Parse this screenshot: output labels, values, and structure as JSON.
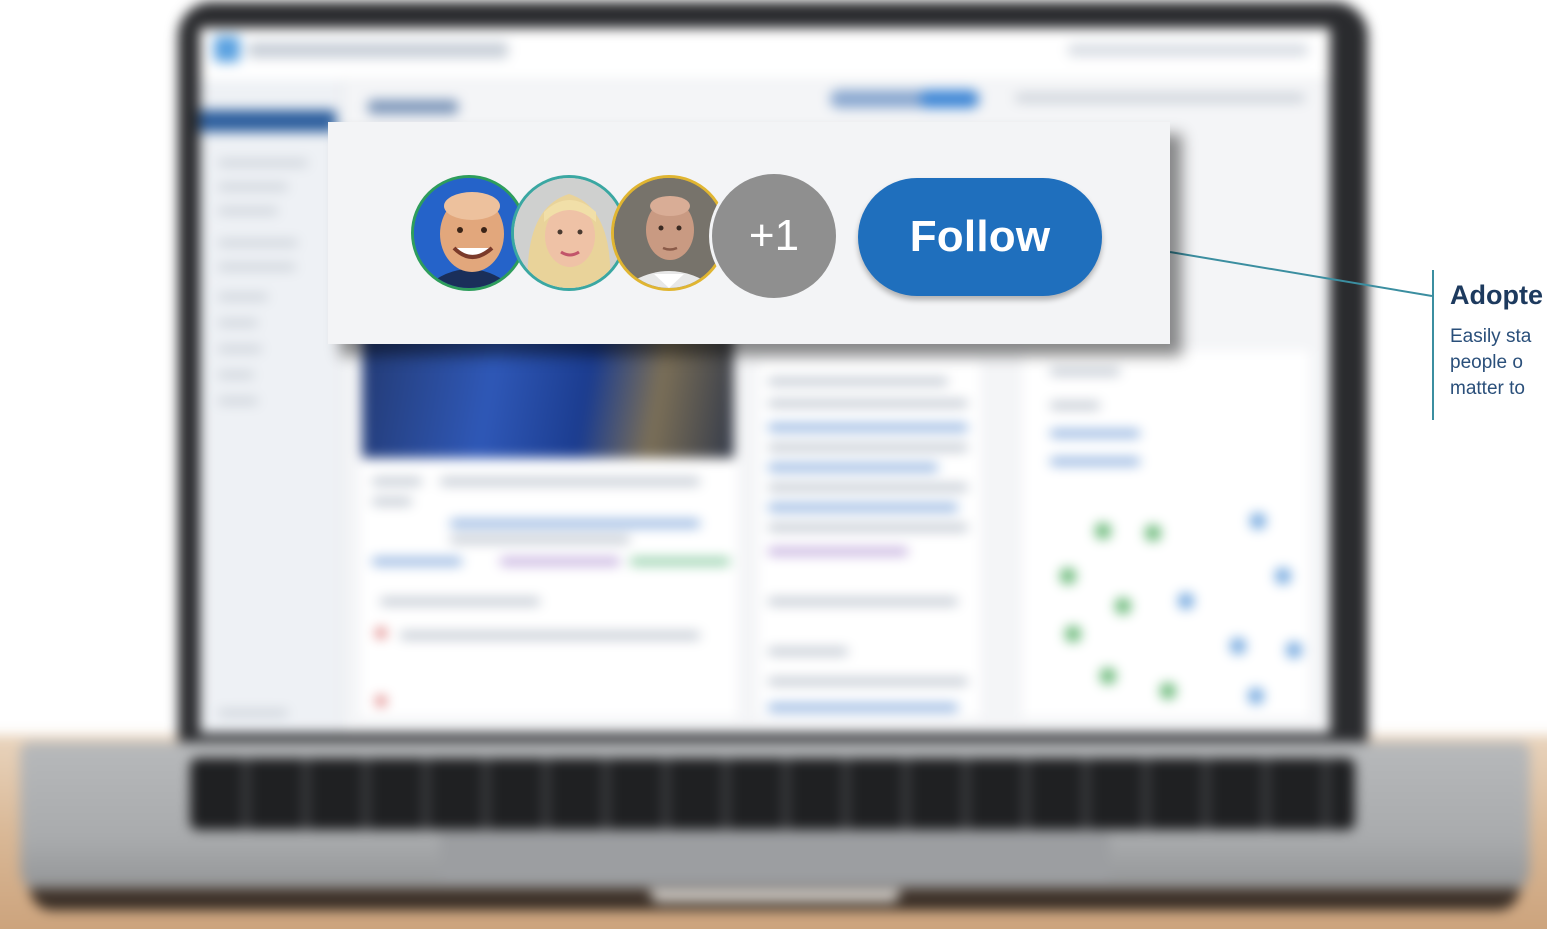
{
  "callout": {
    "extra_count": "+1",
    "follow_label": "Follow",
    "avatars": [
      {
        "ring_color": "#2e9d5c",
        "background": "#2563c9"
      },
      {
        "ring_color": "#3aa7a2",
        "background": "#d9d5cd"
      },
      {
        "ring_color": "#e0b531",
        "background": "#6f6b62"
      }
    ],
    "button_color": "#1f6fbd",
    "count_bubble_color": "#8f8f8f"
  },
  "annotation": {
    "title": "Adopte",
    "lines": [
      "Easily sta",
      "people o",
      "matter to"
    ],
    "accent_color": "#3b8ea0"
  }
}
